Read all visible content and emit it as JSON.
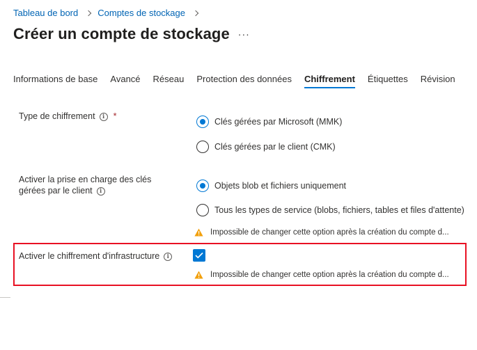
{
  "breadcrumb": {
    "items": [
      "Tableau de bord",
      "Comptes de stockage"
    ]
  },
  "page": {
    "title": "Créer un compte de stockage",
    "more": "···"
  },
  "tabs": [
    "Informations de base",
    "Avancé",
    "Réseau",
    "Protection des données",
    "Chiffrement",
    "Étiquettes",
    "Révision"
  ],
  "active_tab": "Chiffrement",
  "encryption_type": {
    "label": "Type de chiffrement",
    "required_marker": "*",
    "options": [
      "Clés gérées par Microsoft (MMK)",
      "Clés gérées par le client (CMK)"
    ],
    "selected": "Clés gérées par Microsoft (MMK)"
  },
  "cmk_support": {
    "label_line1": "Activer la prise en charge des clés",
    "label_line2": "gérées par le client",
    "options": [
      "Objets blob et fichiers uniquement",
      "Tous les types de service (blobs, fichiers, tables et files d'attente)"
    ],
    "selected": "Objets blob et fichiers uniquement",
    "warning": "Impossible de changer cette option après la création du compte d..."
  },
  "infrastructure_encryption": {
    "label": "Activer le chiffrement d'infrastructure",
    "checked": true,
    "warning": "Impossible de changer cette option après la création du compte d..."
  },
  "icons": {
    "info": "i",
    "warning": "warning-triangle-icon",
    "checkmark": "checkmark-icon"
  },
  "colors": {
    "accent": "#0078d4",
    "link": "#0064b4",
    "warning": "#f2a00c",
    "highlight": "#e81123",
    "required": "#a4262c"
  }
}
